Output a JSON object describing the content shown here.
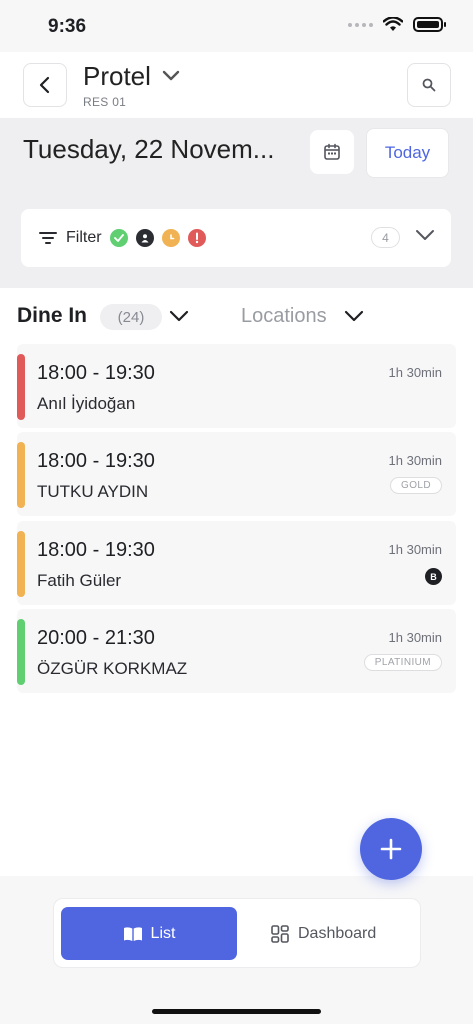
{
  "status_bar": {
    "time": "9:36"
  },
  "header": {
    "title": "Protel",
    "subtitle": "RES 01"
  },
  "date_bar": {
    "date_text": "Tuesday, 22 Novem...",
    "today_label": "Today"
  },
  "filter": {
    "label": "Filter",
    "count": "4"
  },
  "section": {
    "title": "Dine In",
    "count": "(24)",
    "locations_label": "Locations"
  },
  "reservations": [
    {
      "time": "18:00 - 19:30",
      "name": "Anıl İyidoğan",
      "duration": "1h 30min",
      "tag": "",
      "badge": "",
      "color": "#e05a5a"
    },
    {
      "time": "18:00 - 19:30",
      "name": "TUTKU AYDIN",
      "duration": "1h 30min",
      "tag": "GOLD",
      "badge": "",
      "color": "#f0b252"
    },
    {
      "time": "18:00 - 19:30",
      "name": "Fatih Güler",
      "duration": "1h 30min",
      "tag": "",
      "badge": "B",
      "color": "#f0b252"
    },
    {
      "time": "20:00 - 21:30",
      "name": "ÖZGÜR KORKMAZ",
      "duration": "1h 30min",
      "tag": "PLATINIUM",
      "badge": "",
      "color": "#5fcf72"
    }
  ],
  "bottom_nav": {
    "list_label": "List",
    "dashboard_label": "Dashboard"
  },
  "colors": {
    "accent": "#4f66e0",
    "seated": "#5fcf72",
    "waiting": "#f0b252",
    "alert": "#e05a5a"
  }
}
